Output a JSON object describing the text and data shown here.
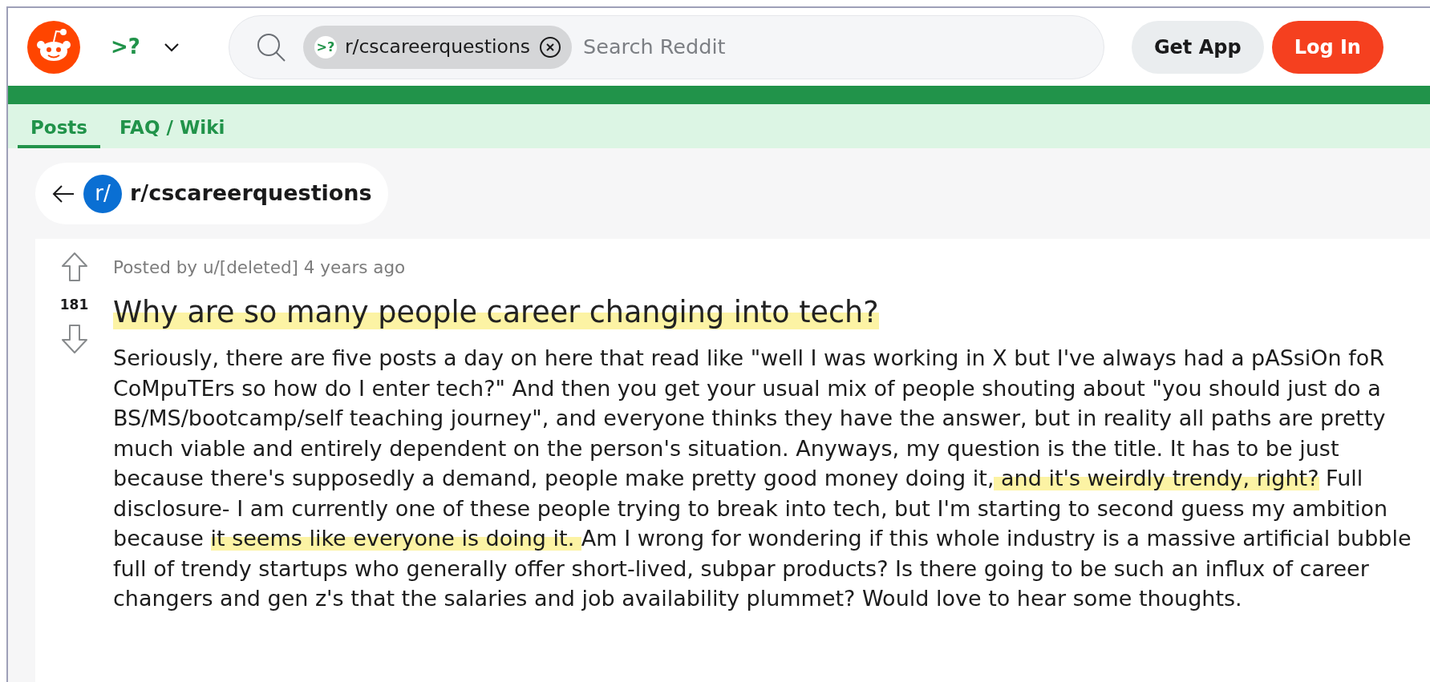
{
  "header": {
    "community_badge": ">?",
    "search": {
      "chip_badge": ">?",
      "chip_label": "r/cscareerquestions",
      "placeholder": "Search Reddit"
    },
    "buttons": [
      {
        "label": "Get App",
        "kind": "secondary"
      },
      {
        "label": "Log In",
        "kind": "primary"
      }
    ]
  },
  "tabs": [
    {
      "label": "Posts",
      "selected": true
    },
    {
      "label": "FAQ / Wiki",
      "selected": false
    }
  ],
  "back_link": {
    "icon_label": "r/",
    "label": "r/cscareerquestions"
  },
  "post": {
    "meta": "Posted by u/[deleted] 4 years ago",
    "votes": "181",
    "title": {
      "text": "Why are so many people career changing into tech?",
      "highlighted": true
    },
    "body": [
      {
        "text": "Seriously, there are five posts a day on here that read like \"well I was working in X but I've always had a pASsiOn foR CoMpuTErs so how do I enter tech?\" And then you get your usual mix of people shouting about \"you should just do a BS/MS/bootcamp/self teaching journey\", and everyone thinks they have the answer, but in reality all paths are pretty much viable and entirely dependent on the person's situation. Anyways, my question is the title. It has to be just because there's supposedly a demand, people make pretty good money doing it,",
        "highlighted": false
      },
      {
        "text": " and it's weirdly trendy, right?",
        "highlighted": true
      },
      {
        "text": " Full disclosure- I am currently one of these people trying to break into tech, but I'm starting to second guess my ambition because ",
        "highlighted": false
      },
      {
        "text": "it seems like everyone is doing it. ",
        "highlighted": true
      },
      {
        "text": "Am I wrong for wondering if this whole industry is a massive artificial bubble full of trendy startups who generally offer short-lived, subpar products? Is there going to be such an influx of career changers and gen z's that the salaries and job availability plummet? Would love to hear some thoughts.",
        "highlighted": false
      }
    ]
  }
}
